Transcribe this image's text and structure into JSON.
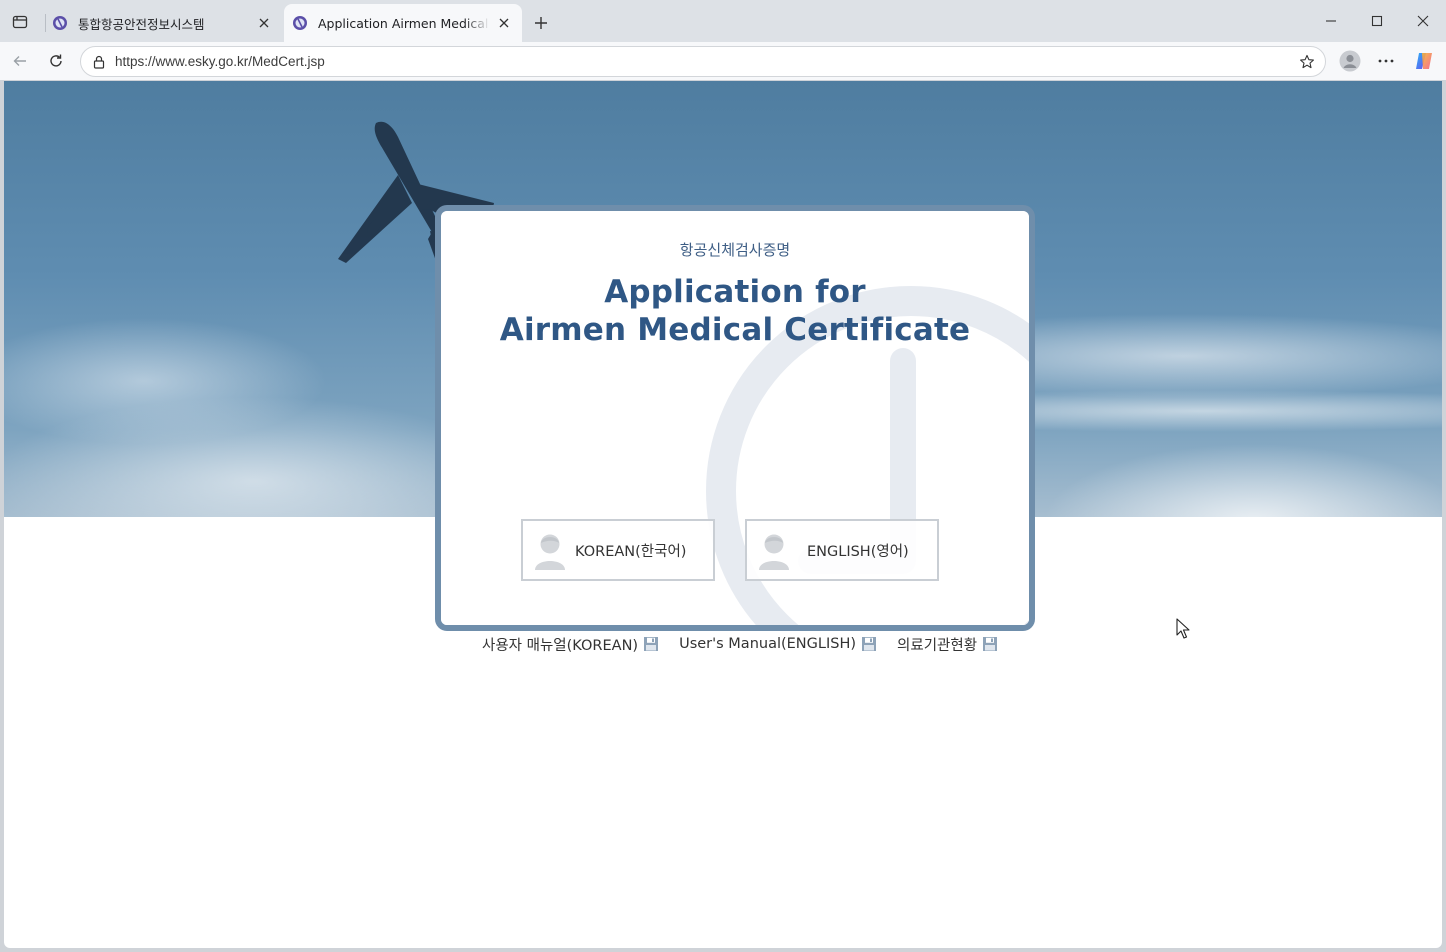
{
  "browser": {
    "tabs": [
      {
        "title": "통합항공안전정보시스템",
        "active": false
      },
      {
        "title": "Application Airmen Medical Certificate",
        "active": true
      }
    ],
    "address": {
      "url": "https://www.esky.go.kr/MedCert.jsp"
    }
  },
  "page": {
    "subtitle": "항공신체검사증명",
    "title_line1": "Application for",
    "title_line2": "Airmen Medical Certificate",
    "buttons": {
      "korean": "KOREAN(한국어)",
      "english": "ENGLISH(영어)"
    },
    "links": {
      "manual_korean": "사용자 매뉴얼(KOREAN)",
      "manual_english": "User's Manual(ENGLISH)",
      "medical_institutions": "의료기관현황"
    }
  },
  "colors": {
    "brand_blue": "#2f5785",
    "frame": "#6f8eab"
  }
}
